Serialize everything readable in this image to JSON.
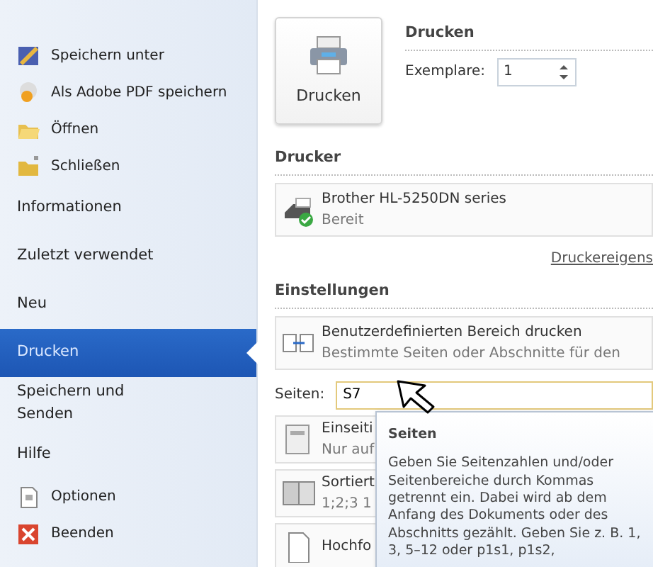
{
  "sidebar": {
    "items": [
      {
        "kind": "command",
        "label": "Speichern unter",
        "selected": false
      },
      {
        "kind": "command",
        "label": "Als Adobe PDF speichern",
        "selected": false
      },
      {
        "kind": "command",
        "label": "Öffnen",
        "selected": false
      },
      {
        "kind": "command",
        "label": "Schließen",
        "selected": false
      },
      {
        "kind": "tab",
        "label": "Informationen",
        "selected": false
      },
      {
        "kind": "tab",
        "label": "Zuletzt verwendet",
        "selected": false
      },
      {
        "kind": "tab",
        "label": "Neu",
        "selected": false
      },
      {
        "kind": "tab",
        "label": "Drucken",
        "selected": true
      },
      {
        "kind": "tab",
        "label": "Speichern und Senden",
        "selected": false
      },
      {
        "kind": "tab",
        "label": "Hilfe",
        "selected": false
      },
      {
        "kind": "command",
        "label": "Optionen",
        "selected": false
      },
      {
        "kind": "command",
        "label": "Beenden",
        "selected": false
      }
    ]
  },
  "print": {
    "button": "Drucken",
    "heading": "Drucken",
    "copies_label": "Exemplare:",
    "copies": "1"
  },
  "printer": {
    "heading": "Drucker",
    "name": "Brother HL-5250DN series",
    "status": "Bereit",
    "properties_link": "Druckereigens"
  },
  "settings": {
    "heading": "Einstellungen",
    "range": {
      "title": "Benutzerdefinierten Bereich drucken",
      "subtitle": "Bestimmte Seiten oder Abschnitte für den"
    },
    "pages_label": "Seiten:",
    "pages_value": "S7",
    "options": [
      {
        "kind": "duplex",
        "title": "Einseiti",
        "subtitle": "Nur auf"
      },
      {
        "kind": "collate",
        "title": "Sortiert",
        "subtitle": "1;2;3   1"
      },
      {
        "kind": "orientation",
        "title": "Hochfo"
      }
    ]
  },
  "tooltip": {
    "title": "Seiten",
    "text": "Geben Sie Seitenzahlen und/oder Seitenbereiche durch Kommas getrennt ein. Dabei wird ab dem Anfang des Dokuments oder des Abschnitts gezählt. Geben Sie z. B. 1, 3, 5–12 oder p1s1, p1s2,"
  }
}
